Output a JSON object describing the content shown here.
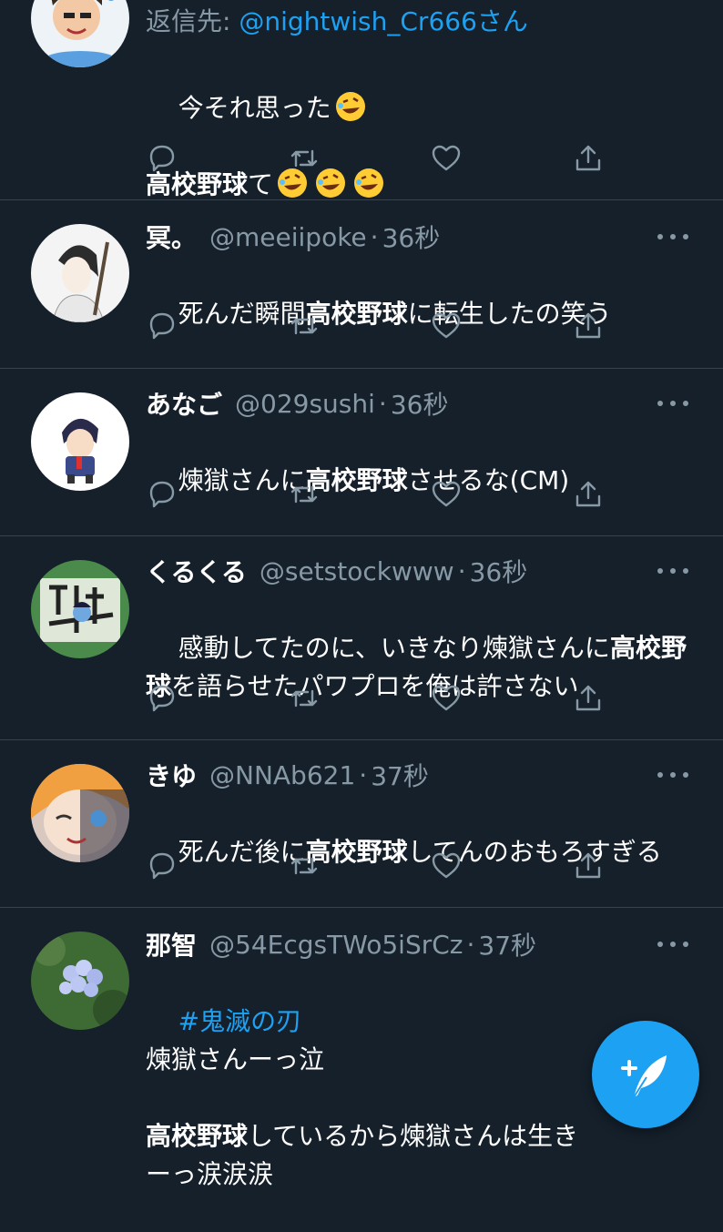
{
  "colors": {
    "background": "#15202b",
    "text": "#ffffff",
    "secondary": "#8899a6",
    "accent": "#1da1f2",
    "divider": "#38444d"
  },
  "tweets": [
    {
      "reply_prefix": "返信先: ",
      "reply_to": "@nightwish_Cr666さん",
      "line1": "今それ思った",
      "line2_bold": "高校野球",
      "line2_rest": "て",
      "emoji": "rolling-on-floor-laughing"
    },
    {
      "name": "冥。",
      "handle": "@meeiipoke",
      "dot": "·",
      "time": "36秒",
      "text_pre": "死んだ瞬間",
      "text_bold": "高校野球",
      "text_post": "に転生したの笑う"
    },
    {
      "name": "あなご",
      "handle": "@029sushi",
      "dot": "·",
      "time": "36秒",
      "text_pre": "煉獄さんに",
      "text_bold": "高校野球",
      "text_post": "させるな(CM)"
    },
    {
      "name": "くるくる",
      "handle": "@setstockwww",
      "dot": "·",
      "time": "36秒",
      "text_pre": "感動してたのに、いきなり煉獄さんに",
      "text_bold": "高校野",
      "text_break": "\n",
      "text_bold2": "球",
      "text_post": "を語らせたパワプロを俺は許さない"
    },
    {
      "name": "きゆ",
      "handle": "@NNAb621",
      "dot": "·",
      "time": "37秒",
      "text_pre": "死んだ後に",
      "text_bold": "高校野球",
      "text_post": "してんのおもろすぎる"
    },
    {
      "name": "那智",
      "handle": "@54EcgsTWo5iSrCz",
      "dot": "·",
      "time": "37秒",
      "hashtag": "#鬼滅の刃",
      "line1": "煉獄さんーっ泣",
      "line2_bold": "高校野球",
      "line2_rest": "しているから煉獄さんは生き",
      "line3": "ーっ涙涙涙"
    }
  ],
  "icons": {
    "reply": "reply-icon",
    "retweet": "retweet-icon",
    "like": "heart-icon",
    "share": "share-icon",
    "more": "more-icon",
    "compose": "compose-tweet-icon"
  }
}
